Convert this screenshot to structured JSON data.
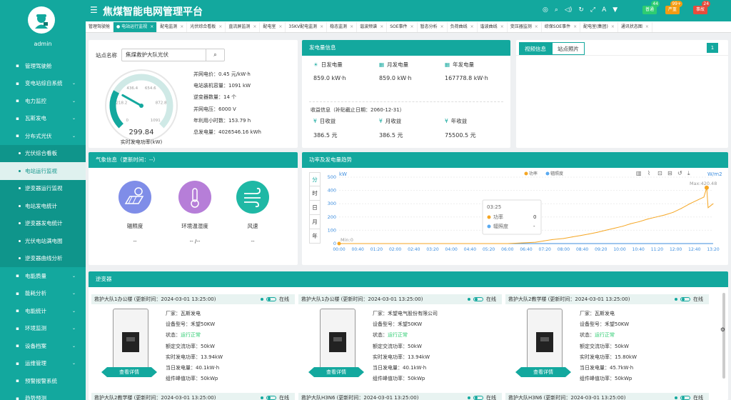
{
  "sidebar": {
    "username": "admin",
    "items": [
      {
        "label": "管理驾驶舱",
        "icon": "dashboard-icon",
        "arrow": false,
        "sub": false,
        "active": false
      },
      {
        "label": "变电站综自系统",
        "icon": "substation-icon",
        "arrow": true,
        "sub": false,
        "active": false
      },
      {
        "label": "电力监控",
        "icon": "power-icon",
        "arrow": true,
        "sub": false,
        "active": false
      },
      {
        "label": "瓦斯发电",
        "icon": "gas-icon",
        "arrow": true,
        "sub": false,
        "active": false
      },
      {
        "label": "分布式光伏",
        "icon": "grid-icon",
        "arrow": true,
        "sub": false,
        "active": false
      },
      {
        "label": "光伏综合看板",
        "sub": true,
        "active": false
      },
      {
        "label": "电站运行监视",
        "sub": true,
        "active": true
      },
      {
        "label": "逆变器运行监视",
        "sub": true,
        "active": false
      },
      {
        "label": "电站发电统计",
        "sub": true,
        "active": false
      },
      {
        "label": "逆变器发电统计",
        "sub": true,
        "active": false
      },
      {
        "label": "光伏电站满电图",
        "sub": true,
        "active": false
      },
      {
        "label": "逆变器曲线分析",
        "sub": true,
        "active": false
      },
      {
        "label": "电能质量",
        "icon": "quality-icon",
        "arrow": true,
        "sub": false,
        "active": false
      },
      {
        "label": "能耗分析",
        "icon": "energy-icon",
        "arrow": true,
        "sub": false,
        "active": false
      },
      {
        "label": "电能统计",
        "icon": "stats-icon",
        "arrow": true,
        "sub": false,
        "active": false
      },
      {
        "label": "环境监测",
        "icon": "env-icon",
        "arrow": true,
        "sub": false,
        "active": false
      },
      {
        "label": "设备档案",
        "icon": "archive-icon",
        "arrow": true,
        "sub": false,
        "active": false
      },
      {
        "label": "运维管理",
        "icon": "ops-icon",
        "arrow": true,
        "sub": false,
        "active": false
      },
      {
        "label": "预警报警系统",
        "icon": "alarm-icon",
        "arrow": false,
        "sub": false,
        "active": false
      },
      {
        "label": "趋势预测",
        "icon": "trend-icon",
        "arrow": false,
        "sub": false,
        "active": false
      }
    ]
  },
  "header": {
    "title": "焦煤智能电网管理平台",
    "badges": [
      {
        "label": "普通",
        "count": "44",
        "color": "#2ecc71"
      },
      {
        "label": "严重",
        "count": "99+",
        "color": "#f39c12"
      },
      {
        "label": "事故",
        "count": "24",
        "color": "#e74c3c"
      }
    ]
  },
  "tabs": [
    "管理驾驶舱",
    "电站运行监视",
    "配电监测",
    "光伏综合看板",
    "直流屏监测",
    "配电室",
    "35KV配电监测",
    "稳态监测",
    "谐波频谱",
    "SOE事件",
    "暂态分析",
    "负荷曲线",
    "谐波曲线",
    "变压器监测",
    "综保SOE事件",
    "配电室(集团)",
    "通讯状态图"
  ],
  "station": {
    "label": "站点名称",
    "value": "焦煤救护大队光伏",
    "gauge_value": "299.84",
    "gauge_label": "实时发电功率(kW)",
    "gauge_ticks": [
      "0",
      "218.2",
      "436.4",
      "654.6",
      "872.8",
      "1091"
    ],
    "gauge_max": 1091,
    "info": [
      "并网电价：0.45 元/kW·h",
      "电站装机容量：1091 kW",
      "逆变器数量：14 个",
      "并网电压：6000 V",
      "年利用小时数：153.79 h",
      "总发电量：4026546.16 kWh"
    ]
  },
  "generation": {
    "title": "发电量信息",
    "day_label": "日发电量",
    "day_val": "859.0 kW·h",
    "month_label": "月发电量",
    "month_val": "859.0 kW·h",
    "year_label": "年发电量",
    "year_val": "167778.8 kW·h",
    "income_title": "收益信息（补贴截止日期：2060-12-31）",
    "d_inc_label": "日收益",
    "d_inc_val": "386.5 元",
    "m_inc_label": "月收益",
    "m_inc_val": "386.5 元",
    "y_inc_label": "年收益",
    "y_inc_val": "75500.5 元"
  },
  "video": {
    "tab1": "视频信息",
    "tab2": "站点照片",
    "page": "1"
  },
  "weather": {
    "title": "气象信息（更新时间：--）",
    "items": [
      {
        "label": "辐照度",
        "value": "--",
        "color": "#7f8de8",
        "icon": "solar-panel-icon"
      },
      {
        "label": "环境温湿度",
        "value": "-- /--",
        "color": "#b67ed8",
        "icon": "thermometer-icon"
      },
      {
        "label": "风速",
        "value": "--",
        "color": "#1fb8a5",
        "icon": "wind-icon"
      }
    ]
  },
  "trend": {
    "title": "功率及发电量趋势",
    "ranges": [
      "分",
      "时",
      "日",
      "月",
      "年"
    ],
    "yunit_left": "kW",
    "yunit_right": "W/m2",
    "tooltip_time": "03:25",
    "tooltip_power_label": "功率",
    "tooltip_power_val": "0",
    "tooltip_irr_label": "辐照度",
    "tooltip_irr_val": "-",
    "max_label": "Max:420.48",
    "min_label": "Min:0"
  },
  "chart_data": {
    "type": "line",
    "title": "",
    "xlabel": "",
    "ylabel": "kW",
    "ylim": [
      0,
      500
    ],
    "yticks": [
      0,
      100,
      200,
      300,
      400,
      500
    ],
    "xtick_labels": [
      "00:00",
      "00:40",
      "01:20",
      "02:00",
      "02:40",
      "03:20",
      "04:00",
      "04:40",
      "05:20",
      "06:00",
      "06:40",
      "07:20",
      "08:00",
      "08:40",
      "09:20",
      "10:00",
      "10:40",
      "11:20",
      "12:00",
      "12:40",
      "13:20"
    ],
    "series": [
      {
        "name": "功率",
        "color": "#f5a623",
        "points": [
          [
            0,
            0
          ],
          [
            6,
            0
          ],
          [
            6.5,
            5
          ],
          [
            7,
            10
          ],
          [
            7.3,
            20
          ],
          [
            7.6,
            30
          ],
          [
            8,
            38
          ],
          [
            8.3,
            50
          ],
          [
            8.6,
            60
          ],
          [
            8.9,
            72
          ],
          [
            9.2,
            85
          ],
          [
            9.5,
            100
          ],
          [
            9.8,
            115
          ],
          [
            10.1,
            130
          ],
          [
            10.4,
            150
          ],
          [
            10.7,
            165
          ],
          [
            11,
            185
          ],
          [
            11.3,
            200
          ],
          [
            11.6,
            215
          ],
          [
            11.9,
            235
          ],
          [
            12.2,
            265
          ],
          [
            12.5,
            300
          ],
          [
            12.8,
            330
          ],
          [
            13,
            350
          ],
          [
            13.1,
            420.48
          ],
          [
            13.15,
            270
          ],
          [
            13.33,
            300
          ]
        ]
      },
      {
        "name": "辐照度",
        "color": "#5aaaf0",
        "points": []
      }
    ],
    "xrange": [
      0,
      13.33
    ]
  },
  "inverters": {
    "title": "逆变器",
    "online_label": "在线",
    "detail_label": "查看详情",
    "cards": [
      {
        "name": "救护大队1办公楼 (更新时间：2024-03-01 13:25:00)",
        "maker": "厂家：瓦斯发电",
        "model": "设备型号：禾望50KW",
        "status_label": "状态：",
        "status": "运行正常",
        "rated": "额定交流功率：50kW",
        "realtime": "实时发电功率：13.94kW",
        "today": "当日发电量：40.1kW·h",
        "peak": "组件峰值功率：50kWp"
      },
      {
        "name": "救护大队1办公楼 (更新时间：2024-03-01 13:25:00)",
        "maker": "厂家：禾望电气股份有限公司",
        "model": "设备型号：禾望50KW",
        "status_label": "状态：",
        "status": "运行正常",
        "rated": "额定交流功率：50kW",
        "realtime": "实时发电功率：13.94kW",
        "today": "当日发电量：40.1kW·h",
        "peak": "组件峰值功率：50kWp"
      },
      {
        "name": "救护大队2教学楼 (更新时间：2024-03-01 13:25:00)",
        "maker": "厂家：瓦斯发电",
        "model": "设备型号：禾望50KW",
        "status_label": "状态：",
        "status": "运行正常",
        "rated": "额定交流功率：50kW",
        "realtime": "实时发电功率：15.80kW",
        "today": "当日发电量：45.7kW·h",
        "peak": "组件峰值功率：50kWp"
      }
    ],
    "next": [
      "救护大队2教学楼 (更新时间：2024-03-01 13:25:00)",
      "救护大队H3N6 (更新时间：2024-03-01 13:25:00)",
      "救护大队H3N6 (更新时间：2024-03-01 13:25:00)"
    ]
  }
}
